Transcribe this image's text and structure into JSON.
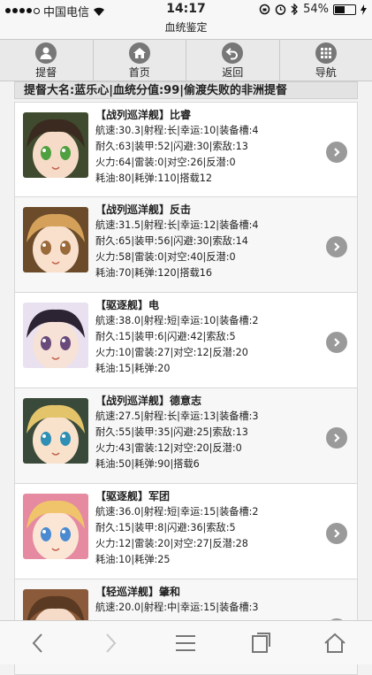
{
  "status": {
    "carrier": "中国电信",
    "time": "14:17",
    "battery": "54%"
  },
  "page_title": "血统鉴定",
  "nav": [
    {
      "label": "提督",
      "icon": "user-icon"
    },
    {
      "label": "首页",
      "icon": "home-icon"
    },
    {
      "label": "返回",
      "icon": "back-icon"
    },
    {
      "label": "导航",
      "icon": "grid-icon"
    }
  ],
  "header": "提督大名:蓝乐心|血统分值:99|偷渡失败的非洲提督",
  "ships": [
    {
      "name": "【战列巡洋舰】比睿",
      "lines": [
        "航速:30.3|射程:长|幸运:10|装备槽:4",
        "耐久:63|装甲:52|闪避:30|索敌:13",
        "火力:64|雷装:0|对空:26|反潜:0",
        "耗油:80|耗弹:110|搭载12"
      ],
      "portrait": {
        "hair": "#3a2a1f",
        "skin": "#f6dcc8",
        "eye": "#4fa040",
        "accent": "#3f4a2e"
      }
    },
    {
      "name": "【战列巡洋舰】反击",
      "lines": [
        "航速:31.5|射程:长|幸运:12|装备槽:4",
        "耐久:65|装甲:56|闪避:30|索敌:14",
        "火力:58|雷装:0|对空:40|反潜:0",
        "耗油:70|耗弹:120|搭载16"
      ],
      "portrait": {
        "hair": "#d5a15a",
        "skin": "#f8e0cc",
        "eye": "#9a6a3a",
        "accent": "#6b4b2a"
      }
    },
    {
      "name": "【驱逐舰】电",
      "lines": [
        "航速:38.0|射程:短|幸运:10|装备槽:2",
        "耐久:15|装甲:6|闪避:42|索敌:5",
        "火力:10|雷装:27|对空:12|反潜:20",
        "耗油:15|耗弹:20"
      ],
      "portrait": {
        "hair": "#2c2433",
        "skin": "#f6e2d6",
        "eye": "#6a4a7a",
        "accent": "#e9e1f0"
      }
    },
    {
      "name": "【战列巡洋舰】德意志",
      "lines": [
        "航速:27.5|射程:长|幸运:13|装备槽:3",
        "耐久:55|装甲:35|闪避:25|索敌:13",
        "火力:43|雷装:12|对空:20|反潜:0",
        "耗油:50|耗弹:90|搭载6"
      ],
      "portrait": {
        "hair": "#e3c46a",
        "skin": "#f8e2cc",
        "eye": "#2f8fb5",
        "accent": "#3a4a3a"
      }
    },
    {
      "name": "【驱逐舰】军团",
      "lines": [
        "航速:36.0|射程:短|幸运:15|装备槽:2",
        "耐久:15|装甲:8|闪避:36|索敌:5",
        "火力:12|雷装:20|对空:27|反潜:28",
        "耗油:10|耗弹:25"
      ],
      "portrait": {
        "hair": "#f0c46a",
        "skin": "#fbe6d6",
        "eye": "#4a8ad0",
        "accent": "#e58aa0"
      }
    },
    {
      "name": "【轻巡洋舰】肇和",
      "lines": [
        "航速:20.0|射程:中|幸运:15|装备槽:3"
      ],
      "portrait": {
        "hair": "#5a3a22",
        "skin": "#f6dcc8",
        "eye": "#6a4a2a",
        "accent": "#8a5a3a"
      }
    }
  ]
}
